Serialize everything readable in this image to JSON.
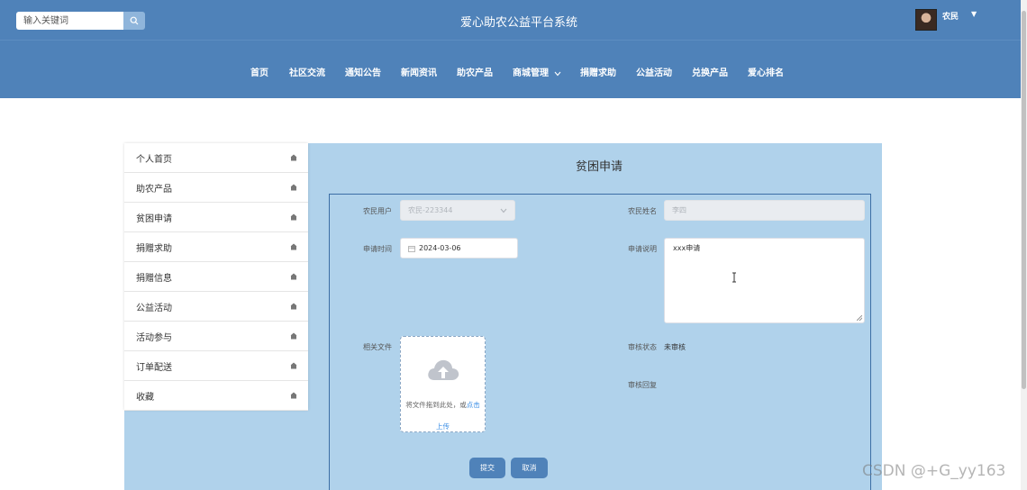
{
  "header": {
    "search_placeholder": "输入关键词",
    "site_title": "爱心助农公益平台系统",
    "user_name": "农民"
  },
  "nav": [
    {
      "label": "首页"
    },
    {
      "label": "社区交流"
    },
    {
      "label": "通知公告"
    },
    {
      "label": "新闻资讯"
    },
    {
      "label": "助农产品"
    },
    {
      "label": "商城管理"
    },
    {
      "label": "捐赠求助"
    },
    {
      "label": "公益活动"
    },
    {
      "label": "兑换产品"
    },
    {
      "label": "爱心排名"
    }
  ],
  "sidebar": {
    "items": [
      {
        "label": "个人首页"
      },
      {
        "label": "助农产品"
      },
      {
        "label": "贫困申请"
      },
      {
        "label": "捐赠求助"
      },
      {
        "label": "捐赠信息"
      },
      {
        "label": "公益活动"
      },
      {
        "label": "活动参与"
      },
      {
        "label": "订单配送"
      },
      {
        "label": "收藏"
      }
    ]
  },
  "form": {
    "title": "贫困申请",
    "farmer_user_label": "农民用户",
    "farmer_user_value": "农民-223344",
    "farmer_name_label": "农民姓名",
    "farmer_name_value": "李四",
    "apply_time_label": "申请时间",
    "apply_time_value": "2024-03-06",
    "apply_desc_label": "申请说明",
    "apply_desc_value": "xxx申请",
    "files_label": "相关文件",
    "upload_hint": "将文件拖到此处，或",
    "upload_link": "点击",
    "upload_link2": "上传",
    "review_status_label": "审核状态",
    "review_status_value": "未审核",
    "review_reply_label": "审核回复",
    "submit_label": "提交",
    "cancel_label": "取消"
  },
  "watermark": "CSDN @+G_yy163",
  "colors": {
    "header_bg": "#4f82b9",
    "panel_bg": "#b0d2eb",
    "button_bg": "#4f82b9",
    "link": "#3a8ee6"
  }
}
